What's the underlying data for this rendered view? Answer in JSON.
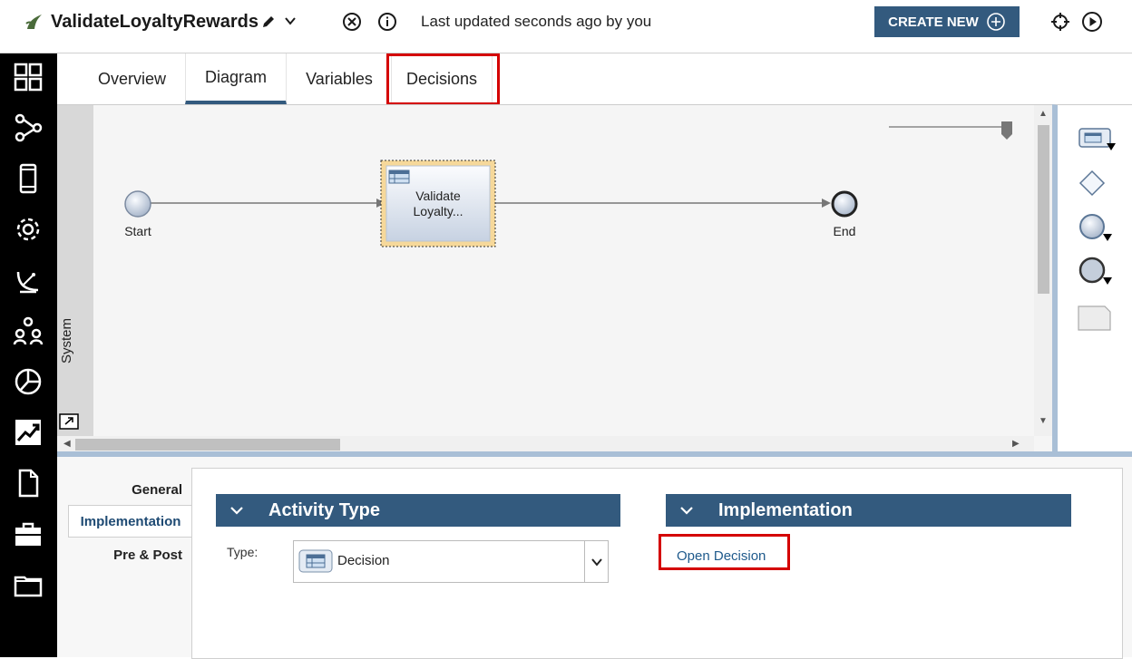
{
  "header": {
    "app_title": "ValidateLoyaltyRewards",
    "status": "Last updated seconds ago by you",
    "create_new_label": "CREATE NEW"
  },
  "tabs": [
    {
      "label": "Overview",
      "active": false
    },
    {
      "label": "Diagram",
      "active": true
    },
    {
      "label": "Variables",
      "active": false
    },
    {
      "label": "Decisions",
      "active": false,
      "highlighted": true
    }
  ],
  "diagram": {
    "lane_label": "System",
    "start_label": "Start",
    "end_label": "End",
    "activity_label_line1": "Validate",
    "activity_label_line2": "Loyalty..."
  },
  "nav_icons": [
    "dashboard-icon",
    "process-icon",
    "mobile-icon",
    "settings-icon",
    "satellite-icon",
    "team-icon",
    "pie-chart-icon",
    "trend-icon",
    "document-icon",
    "toolbox-icon",
    "folder-icon"
  ],
  "palette_icons": [
    "activity-icon",
    "gateway-icon",
    "start-event-icon",
    "end-event-icon",
    "note-icon"
  ],
  "properties": {
    "side_tabs": [
      {
        "label": "General",
        "active": false
      },
      {
        "label": "Implementation",
        "active": true
      },
      {
        "label": "Pre & Post",
        "active": false
      }
    ],
    "activity_type_heading": "Activity Type",
    "implementation_heading": "Implementation",
    "type_label": "Type:",
    "type_value": "Decision",
    "open_decision_link": "Open Decision"
  },
  "colors": {
    "accent": "#335a7e",
    "highlight": "#d40000",
    "selected_activity": "#f6d89a"
  }
}
